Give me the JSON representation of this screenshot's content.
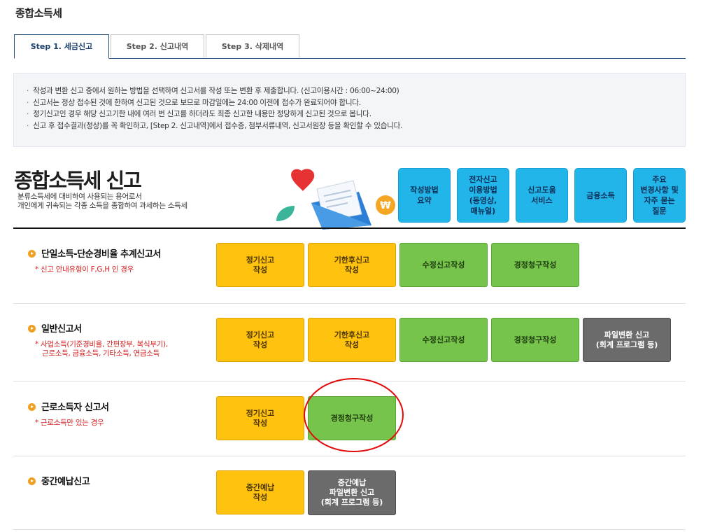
{
  "page_title": "종합소득세",
  "tabs": [
    {
      "label": "Step 1. 세금신고"
    },
    {
      "label": "Step 2. 신고내역"
    },
    {
      "label": "Step 3. 삭제내역"
    }
  ],
  "notice": [
    "작성과 변환 신고 중에서 원하는 방법을 선택하여 신고서를 작성 또는 변환 후 제출합니다. (신고이용시간 : 06:00~24:00)",
    "신고서는 정상 접수된 것에 한하여 신고된 것으로 보므로 마감일에는 24:00 이전에 접수가 완료되어야 합니다.",
    "정기신고인 경우 해당 신고기한 내에 여러 번 신고를 하더라도 최종 신고한 내용만 정당하게 신고된 것으로 봅니다.",
    "신고 후 접수결과(정상)를 꼭 확인하고, [Step 2. 신고내역]에서 접수증, 첨부서류내역, 신고서원장 등을 확인할 수 있습니다."
  ],
  "header": {
    "title": "종합소득세 신고",
    "desc1": "분류소득세에 대비하여 사용되는 용어로서",
    "desc2": "개인에게 귀속되는 각종 소득을 종합하여 과세하는 소득세"
  },
  "quick_buttons": [
    "작성방법\n요약",
    "전자신고\n이용방법\n(동영상,\n매뉴얼)",
    "신고도움\n서비스",
    "금융소득",
    "주요\n변경사항 및\n자주 묻는\n질문"
  ],
  "sections": {
    "simple": {
      "title": "단일소득-단순경비율 추계신고서",
      "note": "* 신고 안내유형이 F,G,H 인 경우",
      "buttons": [
        "정기신고\n작성",
        "기한후신고\n작성",
        "수정신고작성",
        "경정청구작성"
      ]
    },
    "general": {
      "title": "일반신고서",
      "note1": "* 사업소득(기준경비율, 간편장부, 복식부기),",
      "note2": "근로소득, 금융소득, 기타소득, 연금소득",
      "buttons": [
        "정기신고\n작성",
        "기한후신고\n작성",
        "수정신고작성",
        "경정청구작성",
        "파일변환 신고\n(회계 프로그램 등)"
      ]
    },
    "labor": {
      "title": "근로소득자 신고서",
      "note": "* 근로소득만 있는 경우",
      "buttons": [
        "정기신고\n작성",
        "경정청구작성"
      ]
    },
    "interim": {
      "title": "중간예납신고",
      "buttons": [
        "중간예납\n작성",
        "중간예납\n파일변환 신고\n(회계 프로그램 등)"
      ]
    }
  },
  "colors": {
    "yellow_button": "#ffc20e",
    "green_button": "#76c44b",
    "gray_button": "#6b6b6b",
    "quick_button": "#22b5ea",
    "highlight_circle": "#e20a0a"
  }
}
